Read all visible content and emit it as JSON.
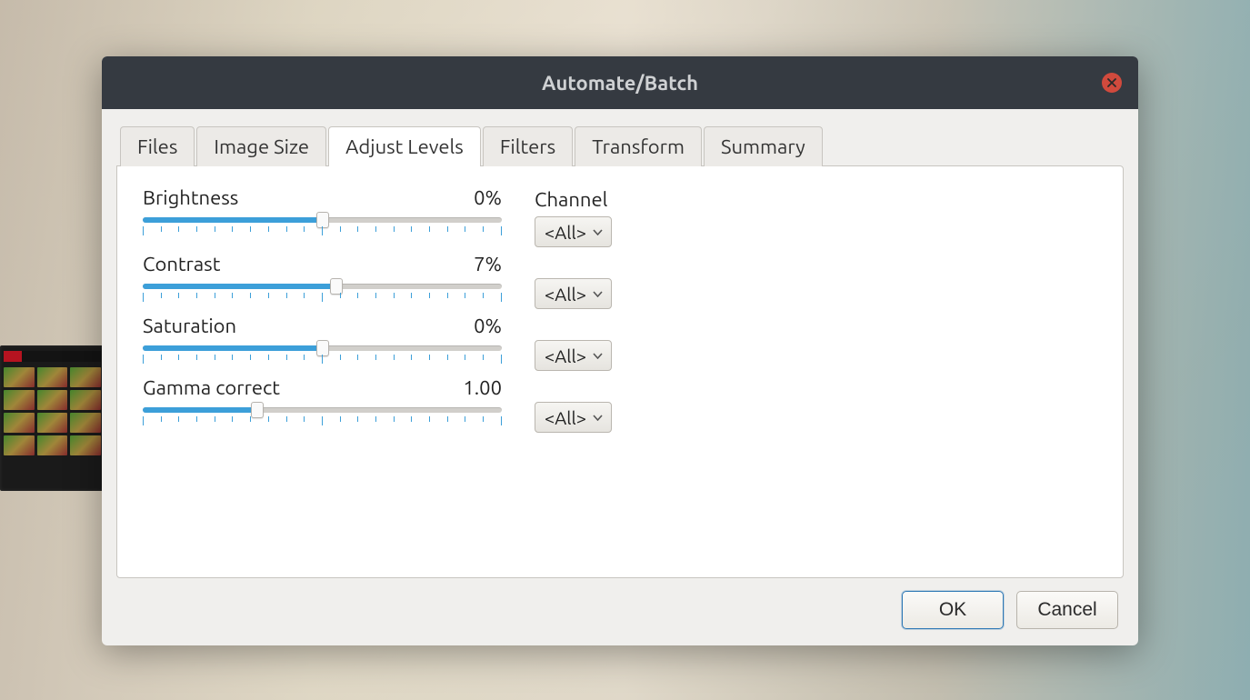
{
  "dialog": {
    "title": "Automate/Batch",
    "footer": {
      "ok": "OK",
      "cancel": "Cancel"
    }
  },
  "tabs": {
    "items": [
      "Files",
      "Image Size",
      "Adjust Levels",
      "Filters",
      "Transform",
      "Summary"
    ],
    "active_index": 2
  },
  "adjust": {
    "channel_header": "Channel",
    "channel_selected": "<All>",
    "rows": [
      {
        "label": "Brightness",
        "value_display": "0%",
        "fill_pct": 50,
        "channel": "<All>"
      },
      {
        "label": "Contrast",
        "value_display": "7%",
        "fill_pct": 54,
        "channel": "<All>"
      },
      {
        "label": "Saturation",
        "value_display": "0%",
        "fill_pct": 50,
        "channel": "<All>"
      },
      {
        "label": "Gamma correct",
        "value_display": "1.00",
        "fill_pct": 32,
        "channel": "<All>"
      }
    ]
  }
}
